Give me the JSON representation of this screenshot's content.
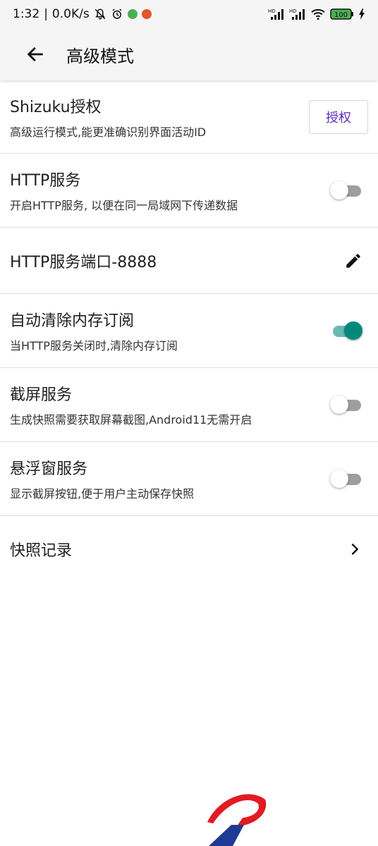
{
  "status_bar": {
    "time": "1:32",
    "net_speed": "0.0K/s",
    "battery": "100",
    "signal_labels": [
      "HD",
      "HD"
    ],
    "colors": {
      "green_dot": "#4caf50",
      "red_dot": "#e2572b",
      "battery_fill": "#4caf50"
    }
  },
  "app_bar": {
    "title": "高级模式",
    "back_icon": "arrow-left"
  },
  "items": {
    "shizuku": {
      "title": "Shizuku授权",
      "subtitle": "高级运行模式,能更准确识别界面活动ID",
      "button_label": "授权"
    },
    "http_service": {
      "title": "HTTP服务",
      "subtitle": "开启HTTP服务, 以便在同一局域网下传递数据",
      "enabled": false
    },
    "http_port": {
      "title": "HTTP服务端口-8888",
      "icon": "edit-pencil"
    },
    "auto_clear": {
      "title": "自动清除内存订阅",
      "subtitle": "当HTTP服务关闭时,清除内存订阅",
      "enabled": true
    },
    "screenshot": {
      "title": "截屏服务",
      "subtitle": "生成快照需要获取屏幕截图,Android11无需开启",
      "enabled": false
    },
    "floating": {
      "title": "悬浮窗服务",
      "subtitle": "显示截屏按钮,便于用户主动保存快照",
      "enabled": false
    },
    "snapshots": {
      "title": "快照记录",
      "icon": "chevron-right"
    }
  },
  "colors": {
    "accent": "#00897b",
    "button_text": "#5b2bc2",
    "logo_red": "#e11b22",
    "logo_blue": "#1f3a93"
  }
}
